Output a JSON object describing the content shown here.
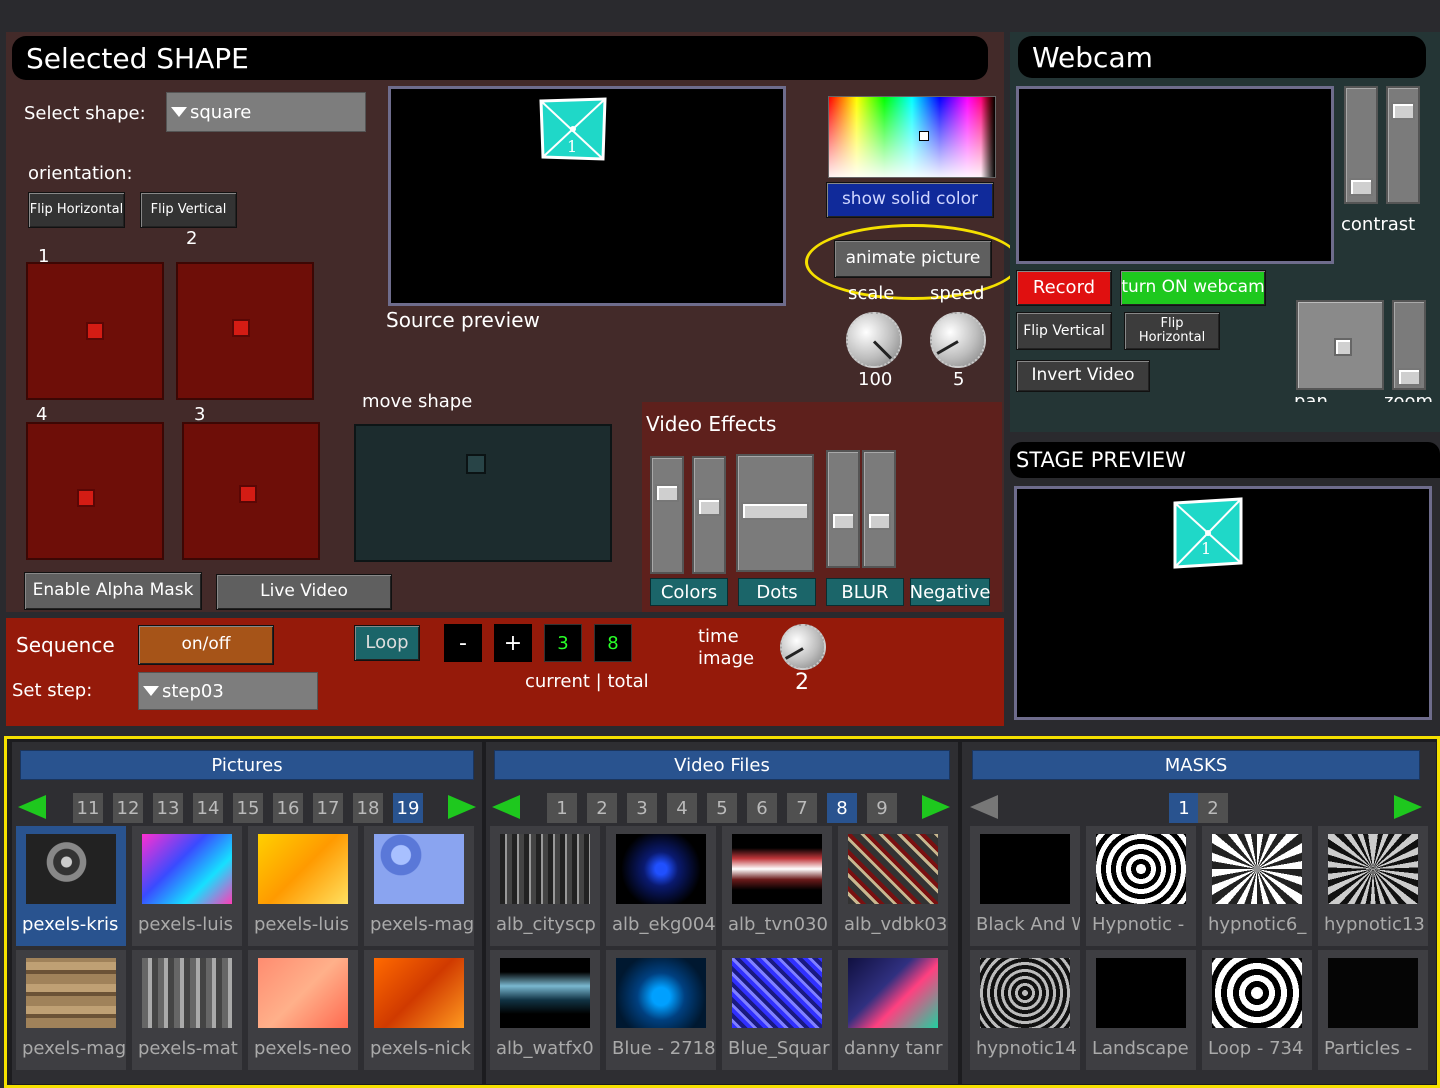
{
  "selected_shape": {
    "title": "Selected SHAPE",
    "select_shape_label": "Select shape:",
    "shape_value": "square",
    "orientation_label": "orientation:",
    "flip_horizontal": "Flip Horizontal",
    "flip_vertical": "Flip Vertical",
    "corner_labels": [
      "1",
      "2",
      "4",
      "3"
    ],
    "source_preview_label": "Source preview",
    "show_solid_color": "show solid color",
    "animate_picture": "animate picture",
    "scale_label": "scale",
    "speed_label": "speed",
    "scale_value": "100",
    "speed_value": "5",
    "move_shape_label": "move shape",
    "enable_alpha_mask": "Enable Alpha Mask",
    "live_video": "Live Video",
    "shape_number": "1"
  },
  "video_effects": {
    "title": "Video Effects",
    "buttons": [
      "Colors",
      "Dots",
      "BLUR",
      "Negative"
    ]
  },
  "sequence": {
    "label": "Sequence",
    "onoff": "on/off",
    "loop": "Loop",
    "minus": "-",
    "plus": "+",
    "current": "3",
    "total": "8",
    "current_total_label": "current | total",
    "time_label": "time",
    "image_label": "image",
    "time_value": "2",
    "set_step_label": "Set step:",
    "step_value": "step03"
  },
  "webcam": {
    "title": "Webcam",
    "contrast_label": "contrast",
    "record": "Record",
    "turn_on": "turn ON webcam",
    "flip_vertical": "Flip Vertical",
    "flip_horizontal": "Flip Horizontal",
    "invert_video": "Invert Video",
    "pan_label": "pan",
    "zoom_label": "zoom"
  },
  "stage_preview": {
    "title": "STAGE PREVIEW",
    "shape_number": "1"
  },
  "pictures": {
    "title": "Pictures",
    "pages": [
      "11",
      "12",
      "13",
      "14",
      "15",
      "16",
      "17",
      "18",
      "19"
    ],
    "active_page": "19",
    "items": [
      "pexels-kris",
      "pexels-luis",
      "pexels-luis",
      "pexels-mag",
      "pexels-mag",
      "pexels-mat",
      "pexels-neo",
      "pexels-nick"
    ]
  },
  "video_files": {
    "title": "Video Files",
    "pages": [
      "1",
      "2",
      "3",
      "4",
      "5",
      "6",
      "7",
      "8",
      "9"
    ],
    "active_page": "8",
    "items": [
      "alb_cityscp",
      "alb_ekg004",
      "alb_tvn030",
      "alb_vdbk03",
      "alb_watfx0",
      "Blue - 2718",
      "Blue_Squar",
      "danny tanr"
    ]
  },
  "masks": {
    "title": "MASKS",
    "pages": [
      "1",
      "2"
    ],
    "active_page": "1",
    "items": [
      "Black And W",
      "Hypnotic -",
      "hypnotic6_",
      "hypnotic13",
      "hypnotic14",
      "Landscape",
      "Loop - 734",
      "Particles -"
    ]
  },
  "colors": {
    "accent_yellow": "#f5e000",
    "record_red": "#e01010",
    "webcam_green": "#1ec81e",
    "shape_cyan": "#1fd8c8",
    "library_blue": "#29538f"
  }
}
